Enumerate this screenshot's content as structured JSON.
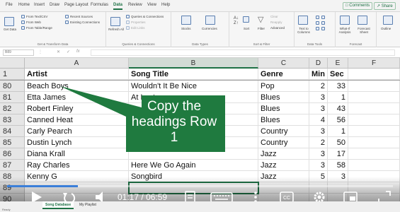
{
  "ribbon_tabs": [
    "File",
    "Home",
    "Insert",
    "Draw",
    "Page Layout",
    "Formulas",
    "Data",
    "Review",
    "View",
    "Help"
  ],
  "active_tab": "Data",
  "share": {
    "comments_label": "Comments",
    "share_label": "Share"
  },
  "ribbon": {
    "get_data": "Get Data",
    "from_text": "From Text/CSV",
    "from_web": "From Web",
    "from_table": "From Table/Range",
    "recent_sources": "Recent Sources",
    "existing_connections": "Existing Connections",
    "group_get": "Get & Transform Data",
    "refresh_all": "Refresh All",
    "queries_connections": "Queries & Connections",
    "properties": "Properties",
    "edit_links": "Edit Links",
    "group_queries": "Queries & Connections",
    "stocks": "Stocks",
    "currencies": "Currencies",
    "group_types": "Data Types",
    "sort": "Sort",
    "filter": "Filter",
    "clear": "Clear",
    "reapply": "Reapply",
    "advanced": "Advanced",
    "group_sort": "Sort & Filter",
    "text_to_columns": "Text to Columns",
    "group_tools": "Data Tools",
    "what_if": "What-If Analysis",
    "forecast_sheet": "Forecast Sheet",
    "group_forecast": "Forecast",
    "outline": "Outline"
  },
  "formula_bar": {
    "name_box": "B89",
    "fx": "fx",
    "value": ""
  },
  "columns": [
    "A",
    "B",
    "C",
    "D",
    "E",
    "F"
  ],
  "selected_column": "B",
  "header_row": {
    "row": "1",
    "values": [
      "Artist",
      "Song Title",
      "Genre",
      "Min",
      "Sec",
      ""
    ]
  },
  "rows": [
    {
      "row": "80",
      "artist": "Beach Boys",
      "song": "Wouldn't It Be Nice",
      "genre": "Pop",
      "min": "2",
      "sec": "33"
    },
    {
      "row": "81",
      "artist": "Etta James",
      "song": "At Last",
      "genre": "Blues",
      "min": "3",
      "sec": "1"
    },
    {
      "row": "82",
      "artist": "Robert Finley",
      "song": "",
      "genre": "Blues",
      "min": "3",
      "sec": "43"
    },
    {
      "row": "83",
      "artist": "Canned Heat",
      "song": "",
      "genre": "Blues",
      "min": "4",
      "sec": "56"
    },
    {
      "row": "84",
      "artist": "Carly Pearch",
      "song": "",
      "genre": "Country",
      "min": "3",
      "sec": "1"
    },
    {
      "row": "85",
      "artist": "Dustin Lynch",
      "song": "",
      "genre": "Country",
      "min": "2",
      "sec": "50"
    },
    {
      "row": "86",
      "artist": "Diana Krall",
      "song": "",
      "genre": "Jazz",
      "min": "3",
      "sec": "17"
    },
    {
      "row": "87",
      "artist": "Ray Charles",
      "song": "Here We Go Again",
      "genre": "Jazz",
      "min": "3",
      "sec": "58"
    },
    {
      "row": "88",
      "artist": "Kenny G",
      "song": "Songbird",
      "genre": "Jazz",
      "min": "5",
      "sec": "3"
    },
    {
      "row": "89",
      "artist": "",
      "song": "",
      "genre": "",
      "min": "",
      "sec": ""
    },
    {
      "row": "90",
      "artist": "",
      "song": "",
      "genre": "",
      "min": "",
      "sec": ""
    }
  ],
  "callout": {
    "text": "Copy the headings Row 1",
    "color": "#1f7a3f"
  },
  "video": {
    "current_time": "01:17",
    "separator": "/",
    "duration": "06:59",
    "progress": 0.184,
    "progress_color": "#3b7fd9"
  },
  "sheets": [
    "Song Database",
    "My Playlist"
  ],
  "active_sheet": "Song Database",
  "status_text": "Ready",
  "accent_color": "#1e7145"
}
